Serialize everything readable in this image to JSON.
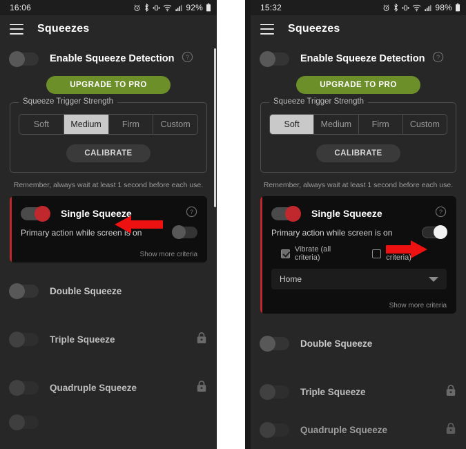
{
  "panels": [
    {
      "id": "left",
      "status_bar": {
        "clock": "16:06",
        "battery_percent": "92%",
        "icons": [
          "alarm-icon",
          "bluetooth-icon",
          "vibrate-icon",
          "wifi-icon",
          "signal-icon",
          "battery-icon"
        ]
      },
      "app_bar": {
        "menu_icon": "hamburger-icon",
        "title": "Squeezes"
      },
      "enable_row": {
        "label": "Enable Squeeze Detection",
        "toggle_state": "off",
        "help_icon": "help-circle-icon"
      },
      "upgrade_button": "UPGRADE TO PRO",
      "trigger_strength": {
        "legend": "Squeeze Trigger Strength",
        "options": [
          "Soft",
          "Medium",
          "Firm",
          "Custom"
        ],
        "selected": "Medium",
        "calibrate_button": "CALIBRATE"
      },
      "hint": "Remember, always wait at least 1 second before each use.",
      "single_card": {
        "title": "Single Squeeze",
        "toggle_state": "on-red",
        "help_icon": "help-circle-icon",
        "primary_label": "Primary action while screen is on",
        "primary_toggle_state": "off",
        "expanded": false,
        "show_more": "Show more criteria"
      },
      "rows": [
        {
          "label": "Double Squeeze",
          "toggle_state": "off",
          "locked": false
        },
        {
          "label": "Triple Squeeze",
          "toggle_state": "off",
          "locked": true,
          "lock_icon": "lock-icon"
        },
        {
          "label": "Quadruple Squeeze",
          "toggle_state": "off",
          "locked": true,
          "lock_icon": "lock-icon"
        },
        {
          "label": "",
          "toggle_state": "off",
          "locked": false
        }
      ],
      "arrow": {
        "name": "red-arrow-left-pointing",
        "direction": "left"
      }
    },
    {
      "id": "right",
      "status_bar": {
        "clock": "15:32",
        "battery_percent": "98%",
        "icons": [
          "alarm-icon",
          "bluetooth-icon",
          "vibrate-icon",
          "wifi-icon",
          "signal-icon",
          "battery-icon"
        ]
      },
      "app_bar": {
        "menu_icon": "hamburger-icon",
        "title": "Squeezes"
      },
      "enable_row": {
        "label": "Enable Squeeze Detection",
        "toggle_state": "off",
        "help_icon": "help-circle-icon"
      },
      "upgrade_button": "UPGRADE TO PRO",
      "trigger_strength": {
        "legend": "Squeeze Trigger Strength",
        "options": [
          "Soft",
          "Medium",
          "Firm",
          "Custom"
        ],
        "selected": "Soft",
        "calibrate_button": "CALIBRATE"
      },
      "hint": "Remember, always wait at least 1 second before each use.",
      "single_card": {
        "title": "Single Squeeze",
        "toggle_state": "on-red",
        "help_icon": "help-circle-icon",
        "primary_label": "Primary action while screen is on",
        "primary_toggle_state": "on",
        "expanded": true,
        "criteria": [
          {
            "label": "Vibrate (all criteria)",
            "checked": true
          },
          {
            "label": "Sound (all criteria)",
            "checked": false
          }
        ],
        "action_dropdown": {
          "value": "Home",
          "caret_icon": "chevron-down-icon"
        },
        "show_more": "Show more criteria"
      },
      "rows": [
        {
          "label": "Double Squeeze",
          "toggle_state": "off",
          "locked": false
        },
        {
          "label": "Triple Squeeze",
          "toggle_state": "off",
          "locked": true,
          "lock_icon": "lock-icon"
        },
        {
          "label": "Quadruple Squeeze",
          "toggle_state": "off",
          "locked": true,
          "lock_icon": "lock-icon"
        }
      ],
      "arrow": {
        "name": "red-arrow-right-pointing",
        "direction": "right"
      }
    }
  ],
  "colors": {
    "background": "#272727",
    "card_background": "#0e0e0e",
    "accent_red": "#c0282d",
    "upgrade_green": "#6d8f2a",
    "arrow_red": "#ee1111",
    "selected_segment": "#c9c9c9"
  }
}
